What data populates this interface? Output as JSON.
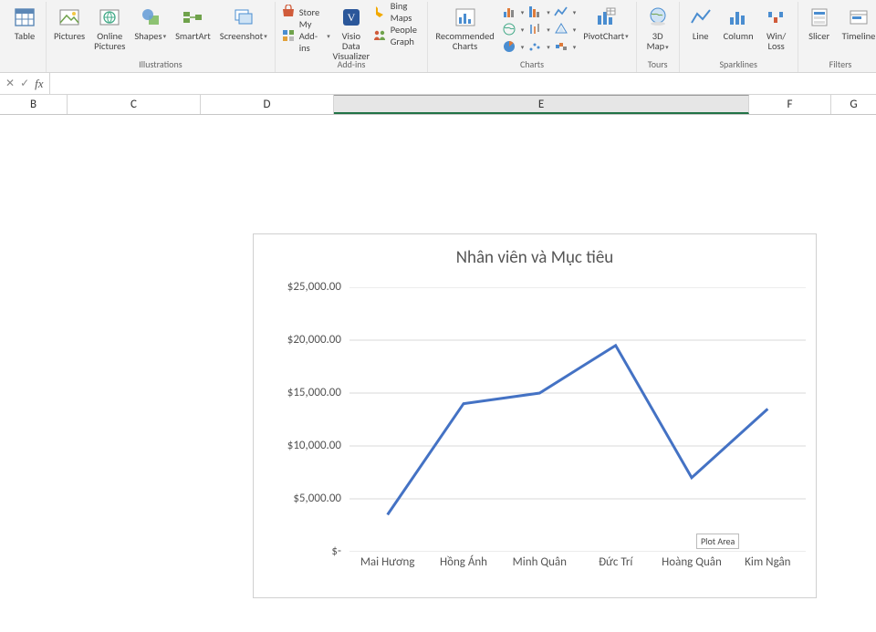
{
  "ribbon": {
    "groups": {
      "tables": {
        "label": "",
        "table": "Table"
      },
      "illustrations": {
        "label": "Illustrations",
        "pictures": "Pictures",
        "online_pictures": "Online\nPictures",
        "shapes": "Shapes",
        "smartart": "SmartArt",
        "screenshot": "Screenshot"
      },
      "addins": {
        "label": "Add-ins",
        "store": "Store",
        "my_addins": "My Add-ins",
        "visio": "Visio Data\nVisualizer",
        "bing": "Bing Maps",
        "people": "People Graph"
      },
      "charts": {
        "label": "Charts",
        "recommended": "Recommended\nCharts",
        "pivotchart": "PivotChart"
      },
      "tours": {
        "label": "Tours",
        "map3d": "3D\nMap"
      },
      "sparklines": {
        "label": "Sparklines",
        "line": "Line",
        "column": "Column",
        "winloss": "Win/\nLoss"
      },
      "filters": {
        "label": "Filters",
        "slicer": "Slicer",
        "timeline": "Timeline"
      }
    }
  },
  "formula_bar": {
    "cancel": "✕",
    "enter": "✓",
    "fx": "fx"
  },
  "columns": [
    "B",
    "C",
    "D",
    "E",
    "F",
    "G"
  ],
  "selected_column": "E",
  "chart_data": {
    "type": "line",
    "title": "Nhân viên và Mục tiêu",
    "categories": [
      "Mai Hương",
      "Hồng Ánh",
      "Minh Quân",
      "Đức Trí",
      "Hoàng Quân",
      "Kim Ngân"
    ],
    "values": [
      3500,
      14000,
      15000,
      19500,
      7000,
      13500
    ],
    "ylabel": "",
    "xlabel": "",
    "ylim": [
      0,
      25000
    ],
    "ytick_labels": [
      "$-",
      "$5,000.00",
      "$10,000.00",
      "$15,000.00",
      "$20,000.00",
      "$25,000.00"
    ],
    "tooltip": "Plot Area"
  }
}
